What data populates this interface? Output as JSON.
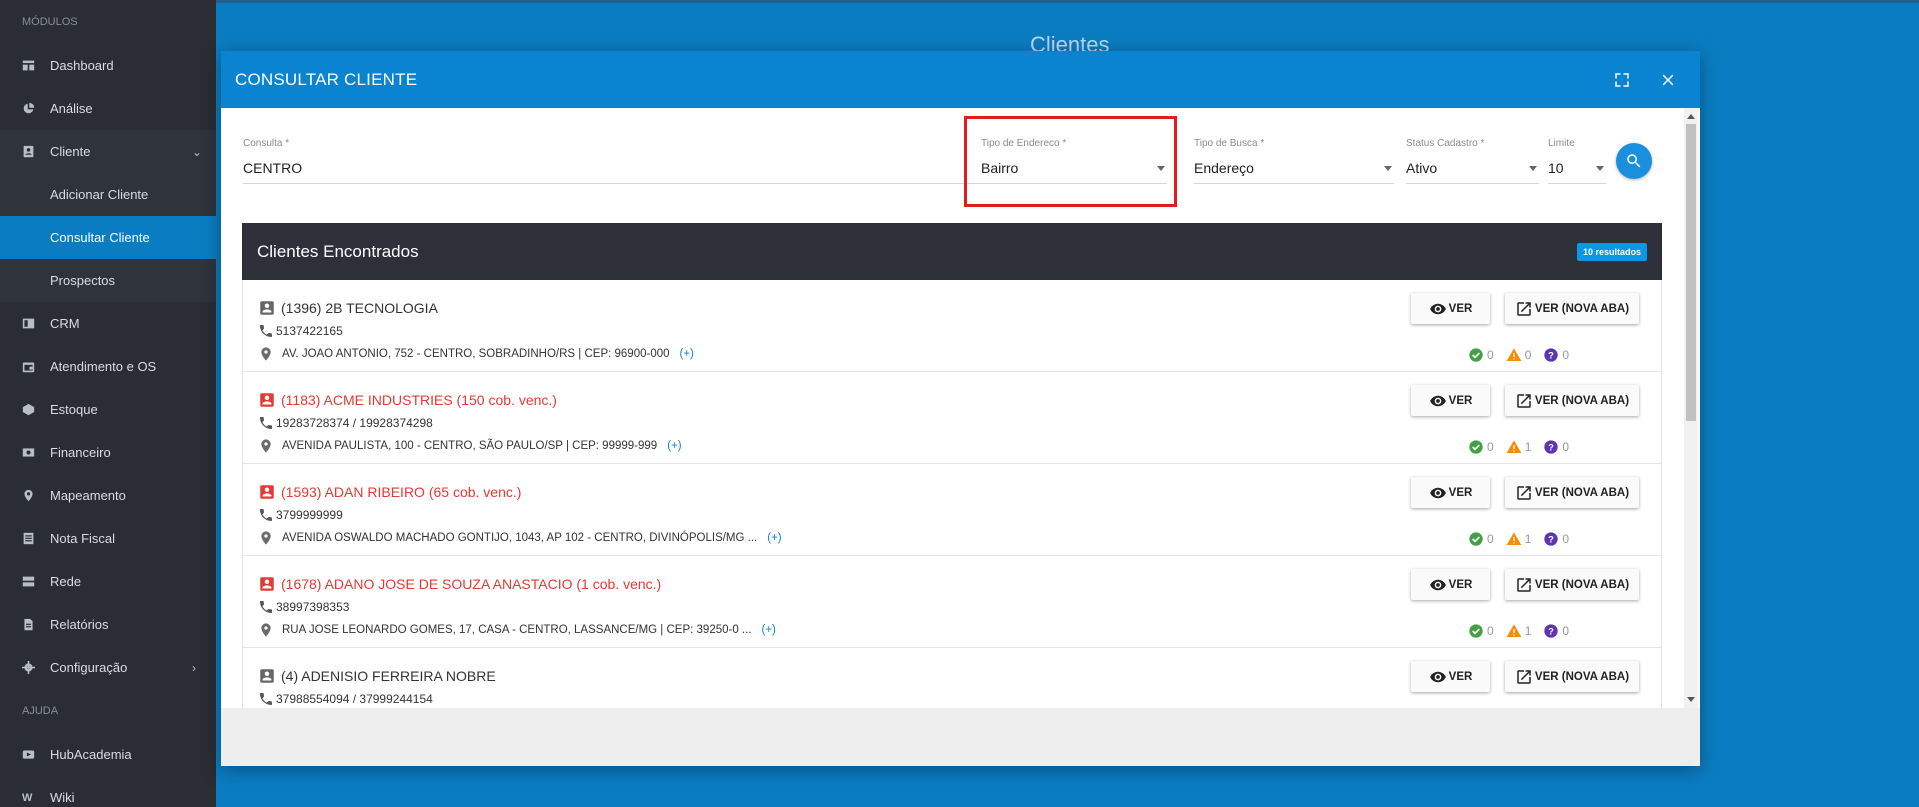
{
  "sidebar": {
    "section_modules": "MÓDULOS",
    "section_help": "AJUDA",
    "items": [
      {
        "label": "Dashboard",
        "icon": "dashboard-icon"
      },
      {
        "label": "Análise",
        "icon": "pie-chart-icon"
      },
      {
        "label": "Cliente",
        "icon": "contact-card-icon"
      },
      {
        "label": "CRM",
        "icon": "board-icon"
      },
      {
        "label": "Atendimento e OS",
        "icon": "calendar-icon"
      },
      {
        "label": "Estoque",
        "icon": "box-icon"
      },
      {
        "label": "Financeiro",
        "icon": "money-icon"
      },
      {
        "label": "Mapeamento",
        "icon": "map-pin-icon"
      },
      {
        "label": "Nota Fiscal",
        "icon": "document-icon"
      },
      {
        "label": "Rede",
        "icon": "server-icon"
      },
      {
        "label": "Relatórios",
        "icon": "file-icon"
      },
      {
        "label": "Configuração",
        "icon": "gear-icon"
      }
    ],
    "cliente_sub": [
      "Adicionar Cliente",
      "Consultar Cliente",
      "Prospectos"
    ],
    "help_items": [
      "HubAcademia",
      "Wiki"
    ]
  },
  "background": {
    "page_title": "Clientes"
  },
  "modal": {
    "title": "CONSULTAR CLIENTE",
    "form": {
      "consulta_label": "Consulta",
      "consulta_value": "CENTRO",
      "tipo_endereco_label": "Tipo de Endereco",
      "tipo_endereco_value": "Bairro",
      "tipo_busca_label": "Tipo de Busca",
      "tipo_busca_value": "Endereço",
      "status_label": "Status Cadastro",
      "status_value": "Ativo",
      "limite_label": "Limite",
      "limite_value": "10",
      "required_mark": "*"
    },
    "results": {
      "title": "Clientes Encontrados",
      "badge": "10 resultados",
      "btn_ver": "VER",
      "btn_nova": "VER (NOVA ABA)",
      "plus": "(+)",
      "clients": [
        {
          "name": "(1396) 2B TECNOLOGIA",
          "overdue": false,
          "phone": "5137422165",
          "address": "AV. JOAO ANTONIO, 752 - CENTRO, SOBRADINHO/RS | CEP: 96900-000",
          "ok": "0",
          "warn": "0",
          "unk": "0"
        },
        {
          "name": "(1183) ACME INDUSTRIES (150 cob. venc.)",
          "overdue": true,
          "phone": "19283728374 / 19928374298",
          "address": "AVENIDA PAULISTA, 100 - CENTRO, SÃO PAULO/SP | CEP: 99999-999",
          "ok": "0",
          "warn": "1",
          "unk": "0"
        },
        {
          "name": "(1593) ADAN RIBEIRO (65 cob. venc.)",
          "overdue": true,
          "phone": "3799999999",
          "address": "AVENIDA OSWALDO MACHADO GONTIJO, 1043, AP 102 - CENTRO, DIVINÓPOLIS/MG ...",
          "ok": "0",
          "warn": "1",
          "unk": "0"
        },
        {
          "name": "(1678) ADANO JOSE DE SOUZA ANASTACIO (1 cob. venc.)",
          "overdue": true,
          "phone": "38997398353",
          "address": "RUA JOSE LEONARDO GOMES, 17, CASA - CENTRO, LASSANCE/MG | CEP: 39250-0 ...",
          "ok": "0",
          "warn": "1",
          "unk": "0"
        },
        {
          "name": "(4) ADENISIO FERREIRA NOBRE",
          "overdue": false,
          "phone": "37988554094 / 37999244154",
          "address": "",
          "ok": "",
          "warn": "",
          "unk": ""
        }
      ]
    }
  },
  "colors": {
    "primary": "#0a84d0",
    "sidebar": "#2a2d33",
    "overdue": "#e53935",
    "highlight": "#e51c1c"
  }
}
